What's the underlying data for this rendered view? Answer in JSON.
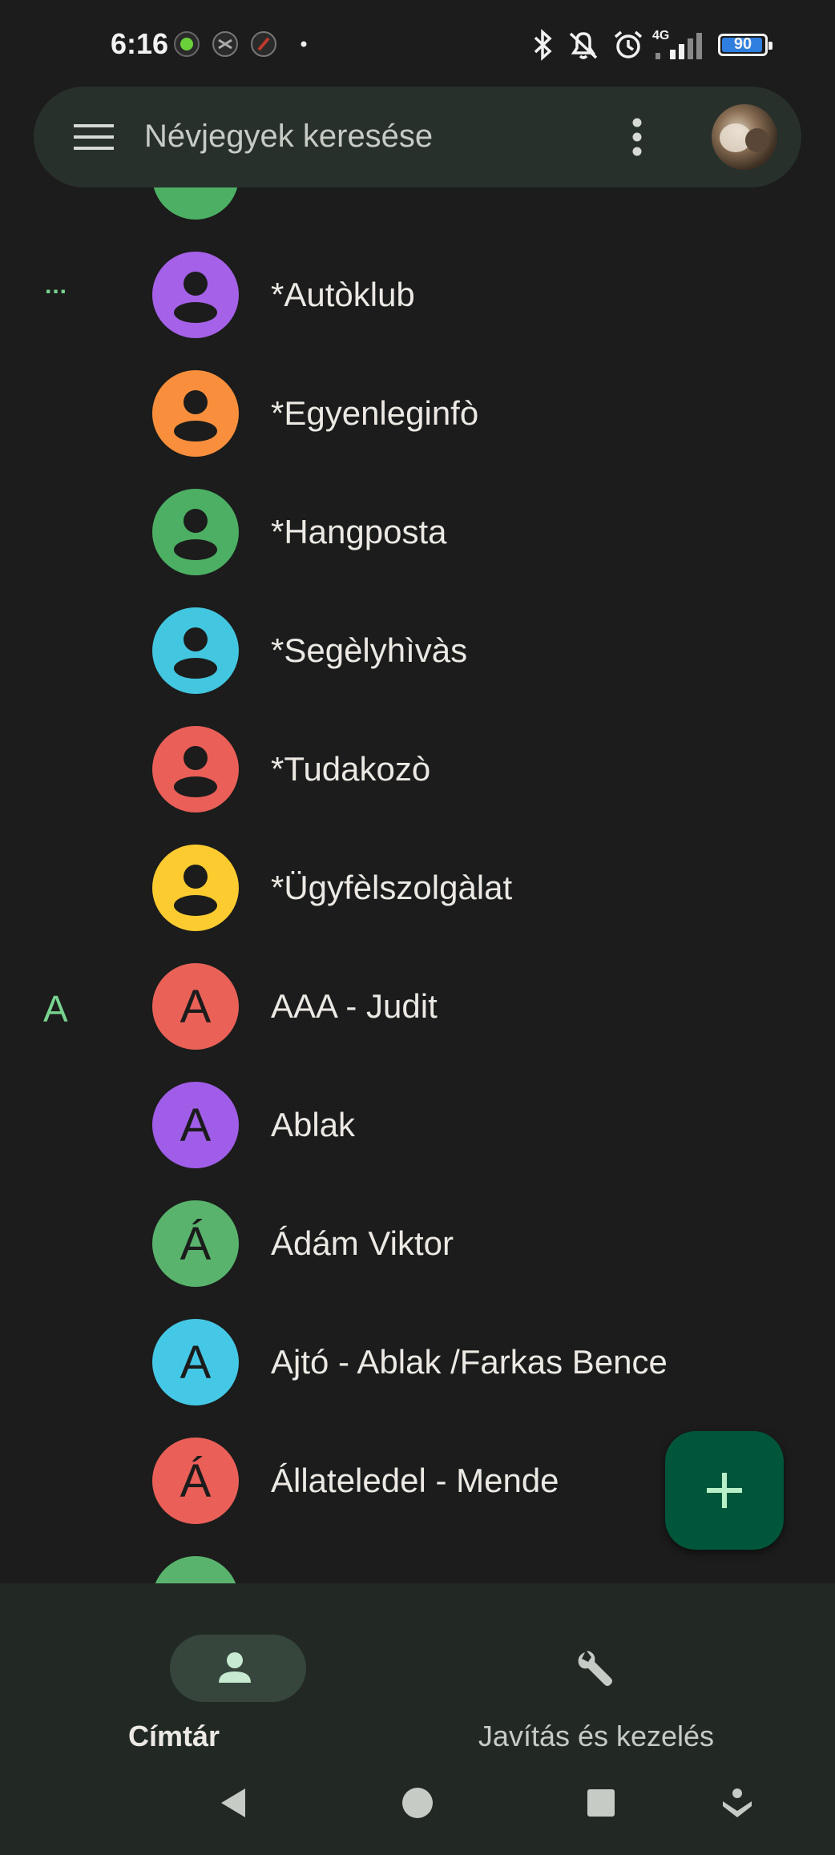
{
  "status_bar": {
    "time": "6:16",
    "network": "4G",
    "battery": "90"
  },
  "search": {
    "label": "Névjegyek keresése"
  },
  "contacts": [
    {
      "section": "...",
      "initial": "",
      "name": "*Autòklub",
      "color": "#a561e8"
    },
    {
      "section": "",
      "initial": "",
      "name": "*Egyenleginfò",
      "color": "#f98f3c"
    },
    {
      "section": "",
      "initial": "",
      "name": "*Hangposta",
      "color": "#4caf63"
    },
    {
      "section": "",
      "initial": "",
      "name": "*Segèlyhìvàs",
      "color": "#43c6e0"
    },
    {
      "section": "",
      "initial": "",
      "name": "*Tudakozò",
      "color": "#ea5f58"
    },
    {
      "section": "",
      "initial": "",
      "name": "*Ügyfèlszolgàlat",
      "color": "#fccb2f"
    },
    {
      "section": "A",
      "initial": "A",
      "name": "AAA - Judit",
      "color": "#ea6158"
    },
    {
      "section": "",
      "initial": "A",
      "name": "Ablak",
      "color": "#a05de8"
    },
    {
      "section": "",
      "initial": "Á",
      "name": "Ádám Viktor",
      "color": "#59b36d"
    },
    {
      "section": "",
      "initial": "A",
      "name": "Ajtó - Ablak /Farkas Bence",
      "color": "#45c8e5"
    },
    {
      "section": "",
      "initial": "Á",
      "name": "Állateledel - Mende",
      "color": "#ea5f58"
    }
  ],
  "bottom_nav": {
    "tab1": "Címtár",
    "tab2": "Javítás és kezelés"
  },
  "colors": {
    "accent": "#78d38f",
    "fab": "#00563a"
  }
}
